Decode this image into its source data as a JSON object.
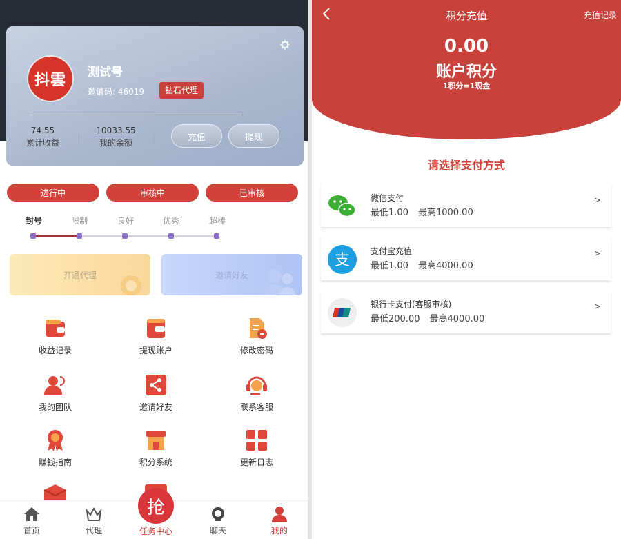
{
  "left": {
    "profile": {
      "avatar_text": "抖雲",
      "username": "测试号",
      "invite_code": "邀请码: 46019",
      "badge": "钻石代理",
      "stats": [
        {
          "value": "74.55",
          "label": "累计收益"
        },
        {
          "value": "10033.55",
          "label": "我的余额"
        }
      ],
      "recharge_label": "充值",
      "withdraw_label": "提现"
    },
    "status_tabs": [
      "进行中",
      "审核中",
      "已审核"
    ],
    "levels": [
      "封号",
      "限制",
      "良好",
      "优秀",
      "超棒"
    ],
    "promos": {
      "agent": "开通代理",
      "invite": "邀请好友"
    },
    "grid": [
      "收益记录",
      "提现账户",
      "修改密码",
      "我的团队",
      "邀请好友",
      "联系客服",
      "赚钱指南",
      "积分系统",
      "更新日志"
    ],
    "tabbar": {
      "home": "首页",
      "agent": "代理",
      "center_icon_text": "抢",
      "task": "任务中心",
      "chat": "聊天",
      "mine": "我的"
    }
  },
  "right": {
    "title": "积分充值",
    "history_link": "充值记录",
    "points_value": "0.00",
    "points_label": "账户积分",
    "ratio": "1积分=1现金",
    "choose_title": "请选择支付方式",
    "methods": [
      {
        "name": "微信支付",
        "min": "最低1.00",
        "max": "最高1000.00",
        "icon": "wechat-icon"
      },
      {
        "name": "支付宝充值",
        "min": "最低1.00",
        "max": "最高4000.00",
        "icon": "alipay-icon"
      },
      {
        "name": "银行卡支付(客服审核)",
        "min": "最低200.00",
        "max": "最高4000.00",
        "icon": "unionpay-icon"
      }
    ],
    "arrow": ">"
  },
  "colors": {
    "brand_red": "#d2423a",
    "hero_red": "#c8413a",
    "dark_header": "#262b36"
  }
}
